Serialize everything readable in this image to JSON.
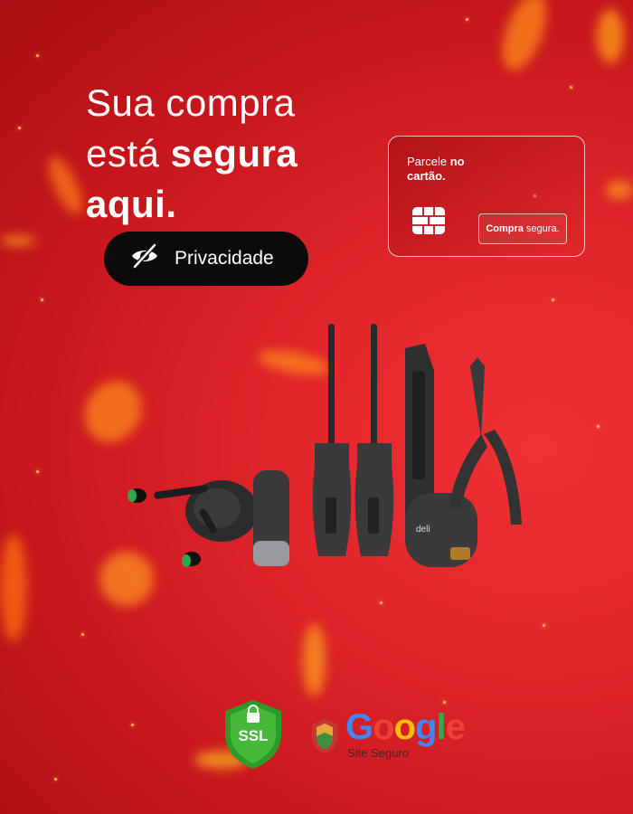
{
  "headline": {
    "line1": "Sua  compra",
    "line2_regular": "está ",
    "line2_bold": "segura",
    "line3_bold": "aqui."
  },
  "privacy_button": {
    "label": "Privacidade",
    "icon": "eye-off-icon"
  },
  "card": {
    "text_regular": "Parcele ",
    "text_bold_1": "no",
    "text_bold_2": "cartão.",
    "button_bold": "Compra",
    "button_regular": "segura.",
    "chip_icon": "card-chip-icon"
  },
  "badges": {
    "ssl_label": "SSL",
    "google_word": "Google",
    "google_sub": "Site Seguro"
  },
  "colors": {
    "background": "#d91f25",
    "button_bg": "#0b0b0b",
    "ssl_green": "#3aa935",
    "google_blue": "#4285F4",
    "google_red": "#EA4335",
    "google_yellow": "#FBBC05",
    "google_green": "#34A853"
  }
}
